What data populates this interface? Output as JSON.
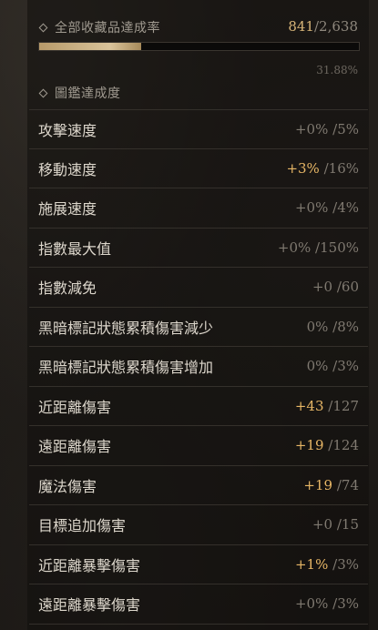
{
  "total": {
    "label": "全部收藏品達成率",
    "current": "841",
    "separator": "/",
    "max": "2,638",
    "percent_text": "31.88%",
    "fill_fraction": 0.3188
  },
  "progress": {
    "label": "圖鑑達成度"
  },
  "stats": [
    {
      "label": "攻擊速度",
      "bonus": "+0%",
      "positive": false,
      "sep": "/",
      "max": "5%"
    },
    {
      "label": "移動速度",
      "bonus": "+3%",
      "positive": true,
      "sep": "/",
      "max": "16%"
    },
    {
      "label": "施展速度",
      "bonus": "+0%",
      "positive": false,
      "sep": "/",
      "max": "4%"
    },
    {
      "label": "指數最大值",
      "bonus": "+0%",
      "positive": false,
      "sep": "/",
      "max": "150%"
    },
    {
      "label": "指數減免",
      "bonus": "+0",
      "positive": false,
      "sep": "/",
      "max": "60"
    },
    {
      "label": "黑暗標記狀態累積傷害減少",
      "bonus": "0%",
      "positive": false,
      "sep": "/",
      "max": "8%"
    },
    {
      "label": "黑暗標記狀態累積傷害增加",
      "bonus": "0%",
      "positive": false,
      "sep": "/",
      "max": "3%"
    },
    {
      "label": "近距離傷害",
      "bonus": "+43",
      "positive": true,
      "sep": "/",
      "max": "127"
    },
    {
      "label": "遠距離傷害",
      "bonus": "+19",
      "positive": true,
      "sep": "/",
      "max": "124"
    },
    {
      "label": "魔法傷害",
      "bonus": "+19",
      "positive": true,
      "sep": "/",
      "max": "74"
    },
    {
      "label": "目標追加傷害",
      "bonus": "+0",
      "positive": false,
      "sep": "/",
      "max": "15"
    },
    {
      "label": "近距離暴擊傷害",
      "bonus": "+1%",
      "positive": true,
      "sep": "/",
      "max": "3%"
    },
    {
      "label": "遠距離暴擊傷害",
      "bonus": "+0%",
      "positive": false,
      "sep": "/",
      "max": "3%"
    }
  ],
  "colors": {
    "accent_gold": "#e8b766",
    "count_gold": "#d6b478",
    "bar_fill": "#d9c39a",
    "muted_text": "#807a71"
  }
}
